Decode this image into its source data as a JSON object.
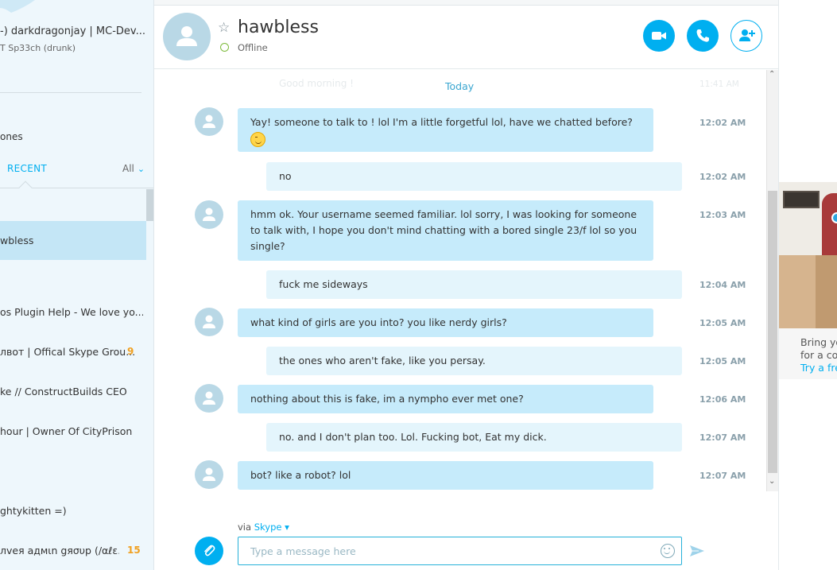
{
  "sidebar": {
    "mood_name": "-) darkdragonjay | MC-Dev...",
    "mood_sub": "T Sp33ch (drunk)",
    "phones_label": "ones",
    "recent_tab": "RECENT",
    "filter_label": "All",
    "items": [
      {
        "label": "wbless",
        "badge": ""
      },
      {
        "label": "os Plugin Help - We love yo...",
        "badge": ""
      },
      {
        "label": "лвот | Offical Skype Grou...",
        "badge": "9"
      },
      {
        "label": "ke // ConstructBuilds CEO",
        "badge": ""
      },
      {
        "label": "hour | Owner Of CityPrison",
        "badge": ""
      },
      {
        "label": "ghtykitten =)",
        "badge": ""
      },
      {
        "label": "лvея адмιn gяσυp (/αℓε...",
        "badge": "15"
      }
    ]
  },
  "header": {
    "contact_name": "hawbless",
    "status": "Offline",
    "status_color": "#7dbb3c",
    "buttons": [
      "video-call-icon",
      "call-icon",
      "add-contact-icon"
    ]
  },
  "conversation": {
    "day_label": "Today",
    "ghost_text": "Good morning !",
    "ghost_time": "11:41 AM",
    "messages": [
      {
        "direction": "in",
        "text": "Yay! someone to talk to ! lol   I'm a little forgetful lol, have we chatted before?",
        "emoji": "wink-emoji",
        "time": "12:02 AM"
      },
      {
        "direction": "out",
        "text": "no",
        "time": "12:02 AM"
      },
      {
        "direction": "in",
        "text": "hmm ok. Your username seemed familiar. lol sorry, I was looking for someone to talk with, I hope you don't mind chatting with a bored single 23/f lol  so you single?",
        "time": "12:03 AM"
      },
      {
        "direction": "out",
        "text": "fuck me sideways",
        "time": "12:04 AM"
      },
      {
        "direction": "in",
        "text": "what kind of girls are you into? you like nerdy girls?",
        "time": "12:05 AM"
      },
      {
        "direction": "out",
        "text": "the ones who aren't fake, like you persay.",
        "time": "12:05 AM"
      },
      {
        "direction": "in",
        "text": "nothing about this is fake, im a nympho ever met one?",
        "time": "12:06 AM"
      },
      {
        "direction": "out",
        "text": "no. and I don't plan too. Lol. Fucking bot, Eat my dick.",
        "time": "12:07 AM"
      },
      {
        "direction": "in",
        "text": "bot? like a robot? lol",
        "time": "12:07 AM"
      }
    ]
  },
  "composer": {
    "via_prefix": "via",
    "via_service": "Skype",
    "placeholder": "Type a message here"
  },
  "ad": {
    "line1": "Bring yo",
    "line2": "for a cof",
    "link": "Try a fre"
  },
  "colors": {
    "accent": "#00aff0",
    "incoming_bubble": "#c6ebfb",
    "outgoing_bubble": "#e4f5fc",
    "sidebar_bg": "#eef7fc",
    "badge": "#f0a020"
  }
}
